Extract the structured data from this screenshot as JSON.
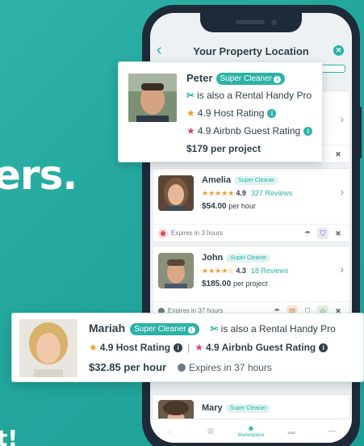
{
  "background": {
    "headline": "ers.",
    "tail": "t!"
  },
  "app": {
    "title": "Your Property Location",
    "progress": 0.5,
    "accent": "#2bb3a7"
  },
  "peter_popup": {
    "name": "Peter",
    "badge": "Super Cleaner",
    "also": "is also a Rental Handy Pro",
    "host_rating": "4.9 Host Rating",
    "guest_rating": "4.9 Airbnb Guest Rating",
    "price": "$179 per project"
  },
  "cards": [
    {
      "name": "Amelia",
      "badge": "Super Cleaner",
      "stars": "★★★★★",
      "rating": "4.9",
      "reviews": "327 Reviews",
      "price": "$54.00",
      "unit": "per hour",
      "expires": "Expires in 3 hours"
    },
    {
      "name": "John",
      "badge": "Super Cleaner",
      "stars": "★★★★☆",
      "rating": "4.3",
      "reviews": "18 Reviews",
      "price": "$185.00",
      "unit": "per project",
      "expires": "Expires in 37 hours"
    },
    {
      "name": "Mary",
      "badge": "Super Cleaner"
    }
  ],
  "mariah_popup": {
    "name": "Mariah",
    "badge": "Super Cleaner",
    "also": "is also a Rental Handy Pro",
    "host_rating": "4.9 Host Rating",
    "guest_rating": "4.9 Airbnb Guest Rating",
    "price": "$32.85 per hour",
    "expires": "Expires in 37 hours"
  },
  "tabbar": {
    "items": [
      {
        "icon": "home-icon"
      },
      {
        "icon": "calendar-icon"
      },
      {
        "icon": "marketplace-icon",
        "label": "Marketplace"
      },
      {
        "icon": "card-icon"
      },
      {
        "icon": "more-icon"
      }
    ]
  }
}
